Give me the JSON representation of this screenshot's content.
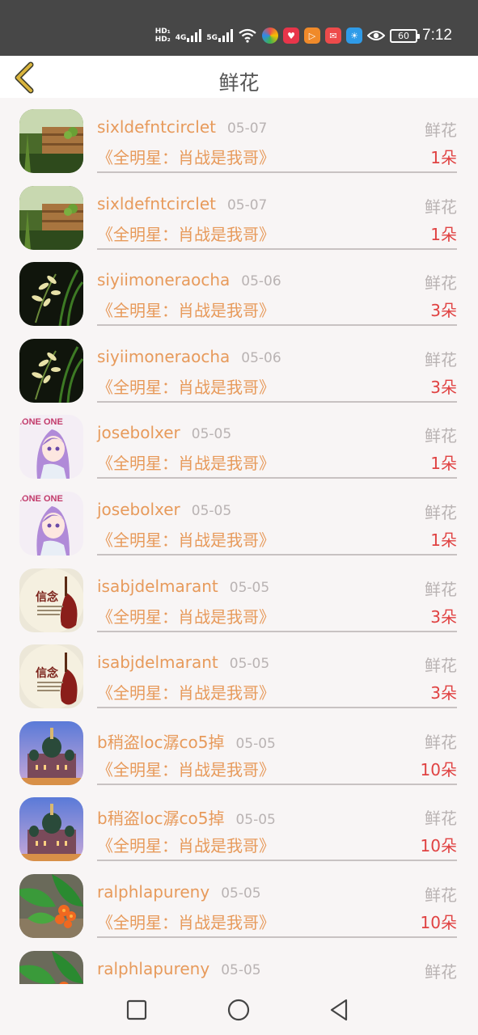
{
  "status_bar": {
    "hd1": "HD₁",
    "hd2": "HD₂",
    "net1": "4G",
    "net2": "5G",
    "battery": "60",
    "time": "7:12"
  },
  "header": {
    "title": "鲜花"
  },
  "items": [
    {
      "name": "sixldefntcirclet",
      "date": "05-07",
      "tag": "鲜花",
      "book": "《全明星：肖战是我哥》",
      "count": "1朵",
      "avatar": "photo-wood-plant"
    },
    {
      "name": "sixldefntcirclet",
      "date": "05-07",
      "tag": "鲜花",
      "book": "《全明星：肖战是我哥》",
      "count": "1朵",
      "avatar": "photo-wood-plant"
    },
    {
      "name": "siyiimoneraocha",
      "date": "05-06",
      "tag": "鲜花",
      "book": "《全明星：肖战是我哥》",
      "count": "3朵",
      "avatar": "photo-orchid"
    },
    {
      "name": "siyiimoneraocha",
      "date": "05-06",
      "tag": "鲜花",
      "book": "《全明星：肖战是我哥》",
      "count": "3朵",
      "avatar": "photo-orchid"
    },
    {
      "name": "josebolxer",
      "date": "05-05",
      "tag": "鲜花",
      "book": "《全明星：肖战是我哥》",
      "count": "1朵",
      "avatar": "anime-girl"
    },
    {
      "name": "josebolxer",
      "date": "05-05",
      "tag": "鲜花",
      "book": "《全明星：肖战是我哥》",
      "count": "1朵",
      "avatar": "anime-girl"
    },
    {
      "name": "isabjdelmarant",
      "date": "05-05",
      "tag": "鲜花",
      "book": "《全明星：肖战是我哥》",
      "count": "3朵",
      "avatar": "xinnian-violin",
      "avatar_text": "信念"
    },
    {
      "name": "isabjdelmarant",
      "date": "05-05",
      "tag": "鲜花",
      "book": "《全明星：肖战是我哥》",
      "count": "3朵",
      "avatar": "xinnian-violin",
      "avatar_text": "信念"
    },
    {
      "name": "b稍盗loc潺co5掉",
      "date": "05-05",
      "tag": "鲜花",
      "book": "《全明星：肖战是我哥》",
      "count": "10朵",
      "avatar": "photo-cathedral"
    },
    {
      "name": "b稍盗loc潺co5掉",
      "date": "05-05",
      "tag": "鲜花",
      "book": "《全明星：肖战是我哥》",
      "count": "10朵",
      "avatar": "photo-cathedral"
    },
    {
      "name": "ralphlapureny",
      "date": "05-05",
      "tag": "鲜花",
      "book": "《全明星：肖战是我哥》",
      "count": "10朵",
      "avatar": "photo-orange-flower"
    },
    {
      "name": "ralphlapureny",
      "date": "05-05",
      "tag": "鲜花",
      "book": "",
      "count": "",
      "avatar": "photo-orange-flower"
    }
  ],
  "colors": {
    "name": "#e79a5b",
    "muted": "#b9b3b3",
    "count": "#e04242",
    "back_arrow": "#d9b43c"
  },
  "nav": {
    "recent": "square-icon",
    "home": "circle-icon",
    "back": "triangle-back-icon"
  }
}
